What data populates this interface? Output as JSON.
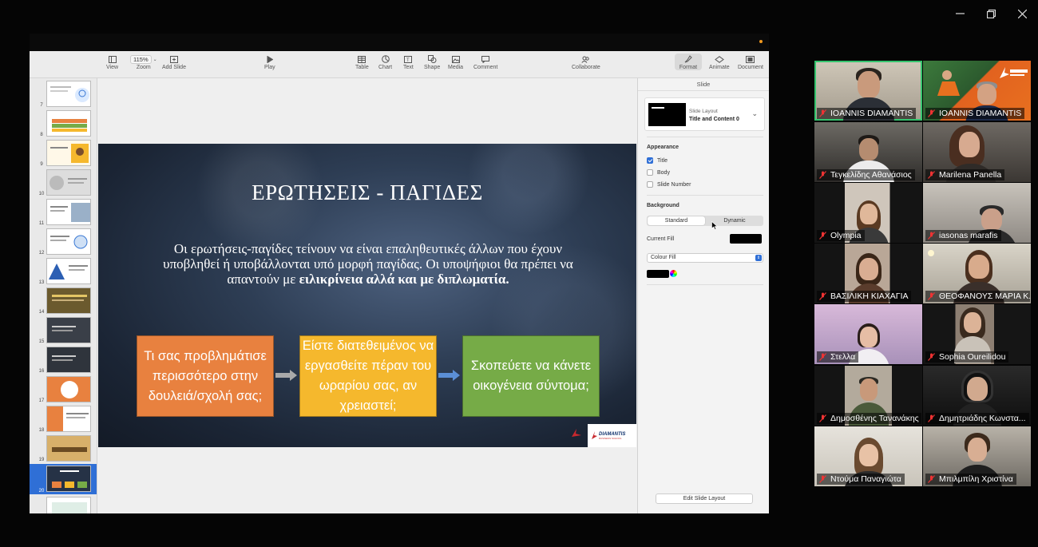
{
  "window_controls": {
    "minimize": "─",
    "restore": "❐",
    "close": "✕"
  },
  "toolbar": {
    "view": "View",
    "zoom": "Zoom",
    "zoom_value": "115%",
    "add_slide": "Add Slide",
    "play": "Play",
    "table": "Table",
    "chart": "Chart",
    "text": "Text",
    "shape": "Shape",
    "media": "Media",
    "comment": "Comment",
    "collaborate": "Collaborate",
    "format": "Format",
    "animate": "Animate",
    "document": "Document"
  },
  "navigator": {
    "slide_numbers": [
      "7",
      "8",
      "9",
      "10",
      "11",
      "12",
      "13",
      "14",
      "15",
      "16",
      "17",
      "18",
      "19",
      "20"
    ],
    "selected": "20"
  },
  "slide": {
    "title": "ΕΡΩΤΗΣΕΙΣ - ΠΑΓΙΔΕΣ",
    "body_1": "Οι ερωτήσεις-παγίδες τείνουν να είναι επαληθευτικές άλλων που έχουν υποβληθεί ή υποβάλλονται  υπό μορφή παγίδας. Οι υποψήφιοι θα πρέπει να απαντούν με ",
    "body_bold": "ειλικρίνεια αλλά και με  διπλωματία.",
    "box_1": "Τι σας προβλημάτισε περισσότερο στην δουλειά/σχολή σας;",
    "box_2": "Είστε διατεθειμένος να εργασθείτε πέραν του ωραρίου σας, αν χρειαστεί;",
    "box_3": "Σκοπεύετε να κάνετε οικογένεια σύντομα;",
    "logo_text": "DIAMANTIS",
    "logo_sub": "BUSINESS SCHOOL",
    "colors": {
      "box_1": "#e8813f",
      "box_2": "#f5b82d",
      "box_3": "#76ab47"
    }
  },
  "inspector": {
    "tab": "Slide",
    "layout_label": "Slide Layout",
    "layout_value": "Title and Content 0",
    "appearance": "Appearance",
    "opt_title": "Title",
    "opt_body": "Body",
    "opt_slide_number": "Slide Number",
    "background": "Background",
    "seg_standard": "Standard",
    "seg_dynamic": "Dynamic",
    "current_fill": "Current Fill",
    "fill_type": "Colour Fill",
    "edit_layout": "Edit Slide Layout"
  },
  "participants": [
    {
      "name": "IOANNIS DIAMANTIS",
      "active": true
    },
    {
      "name": "IOANNIS DIAMANTIS"
    },
    {
      "name": "Τεγκελίδης Αθανάσιος"
    },
    {
      "name": "Marilena Panella"
    },
    {
      "name": "Olympia"
    },
    {
      "name": "iasonas marafis"
    },
    {
      "name": "ΒΑΣΙΛΙΚΗ ΚΙΑΧΑΓΙΑ"
    },
    {
      "name": "ΘΕΟΦΑΝΟΥΣ ΜΑΡΙΑ Κ..."
    },
    {
      "name": "Στελλα"
    },
    {
      "name": "Sophia Oureilidou"
    },
    {
      "name": "Δημοσθένης Τανανάκης"
    },
    {
      "name": "Δημητριάδης Κωνστα..."
    },
    {
      "name": "Ντούμα Παναγιώτα"
    },
    {
      "name": "Μπιλμπίλη Χριστίνα"
    }
  ]
}
